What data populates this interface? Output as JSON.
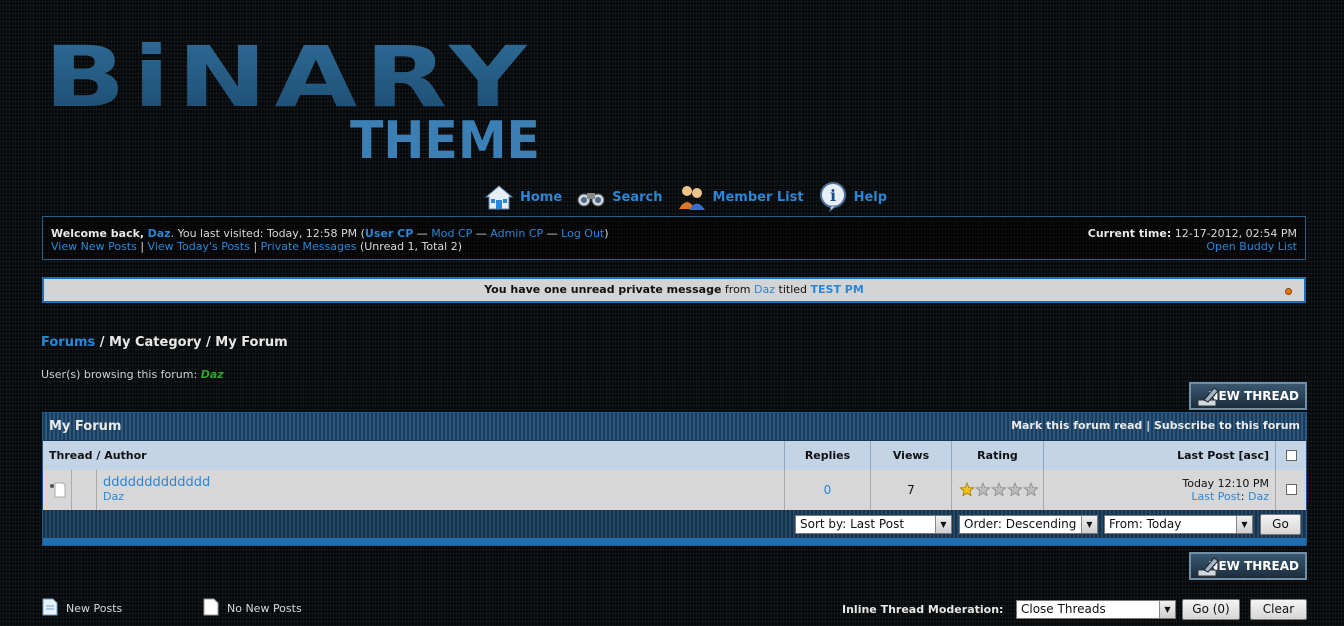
{
  "logo": {
    "line1": "BiNARY",
    "line2": "THEME"
  },
  "nav": [
    {
      "label": "Home",
      "icon": "home-icon"
    },
    {
      "label": "Search",
      "icon": "binoculars-icon"
    },
    {
      "label": "Member List",
      "icon": "members-icon"
    },
    {
      "label": "Help",
      "icon": "help-icon"
    }
  ],
  "welcome": {
    "prefix": "Welcome back,",
    "user": "Daz",
    "visited": ". You last visited: Today, 12:58 PM (",
    "user_cp": "User CP",
    "sep1": " — ",
    "mod_cp": "Mod CP",
    "sep2": " — ",
    "admin_cp": "Admin CP",
    "sep3": " — ",
    "logout": "Log Out",
    "close": ")",
    "view_new": "View New Posts",
    "view_today": "View Today's Posts",
    "pm": "Private Messages",
    "pm_counts": "(Unread 1, Total 2)",
    "pipe": " | ",
    "time_label": "Current time:",
    "time_value": "12-17-2012, 02:54 PM",
    "buddy": "Open Buddy List"
  },
  "pm_notice": {
    "text": "You have one unread private message",
    "from": "from",
    "sender": "Daz",
    "titled": "titled",
    "subject": "TEST PM"
  },
  "breadcrumb": {
    "forums": "Forums",
    "sep": " / ",
    "category": "My Category",
    "forum": "My Forum"
  },
  "browsing": {
    "label": "User(s) browsing this forum:",
    "user": "Daz"
  },
  "new_thread_label": "NEW THREAD",
  "forum": {
    "title": "My Forum",
    "mark_read": "Mark this forum read",
    "pipe": " | ",
    "subscribe": "Subscribe to this forum",
    "columns": {
      "thread": "Thread / Author",
      "replies": "Replies",
      "views": "Views",
      "rating": "Rating",
      "lastpost": "Last Post [asc]"
    },
    "threads": [
      {
        "title": "ddddddddddddd",
        "author": "Daz",
        "replies": "0",
        "views": "7",
        "rating_stars": 1,
        "last_time": "Today 12:10 PM",
        "last_label": "Last Post",
        "last_user": "Daz"
      }
    ],
    "sort_by": "Sort by: Last Post",
    "order": "Order: Descending",
    "from": "From: Today",
    "go": "Go"
  },
  "legend": {
    "new_posts": "New Posts",
    "no_new_posts": "No New Posts"
  },
  "moderation": {
    "label": "Inline Thread Moderation:",
    "action": "Close Threads",
    "go": "Go (0)",
    "clear": "Clear"
  }
}
